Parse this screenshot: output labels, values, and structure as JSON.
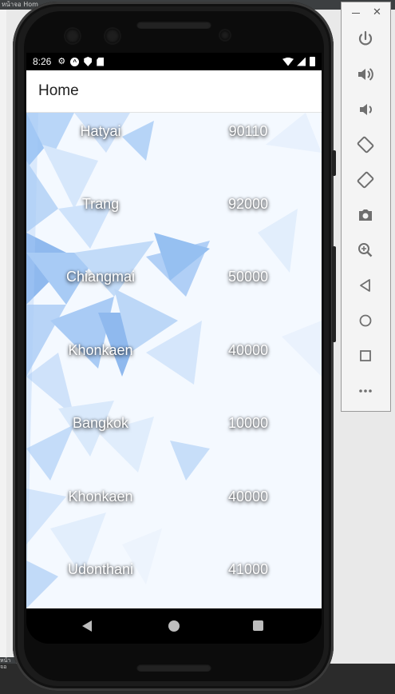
{
  "host": {
    "tab_text": "หน้าจอ  Hom",
    "bottom_text": "หน้าจอ"
  },
  "status_bar": {
    "time": "8:26"
  },
  "app_bar": {
    "title": "Home"
  },
  "list": [
    {
      "city": "Hatyai",
      "zip": "90110"
    },
    {
      "city": "Trang",
      "zip": "92000"
    },
    {
      "city": "Chiangmai",
      "zip": "50000"
    },
    {
      "city": "Khonkaen",
      "zip": "40000"
    },
    {
      "city": "Bangkok",
      "zip": "10000"
    },
    {
      "city": "Khonkaen",
      "zip": "40000"
    },
    {
      "city": "Udonthani",
      "zip": "41000"
    }
  ],
  "emulator_toolbar": {
    "buttons": [
      "power-icon",
      "volume-up-icon",
      "volume-down-icon",
      "rotate-left-icon",
      "rotate-right-icon",
      "camera-icon",
      "zoom-icon",
      "back-icon",
      "home-icon",
      "overview-icon",
      "more-icon"
    ]
  },
  "colors": {
    "accent_blue": "#8fb9ee",
    "light_blue": "#d7e8fb",
    "status_bar": "#000000"
  }
}
